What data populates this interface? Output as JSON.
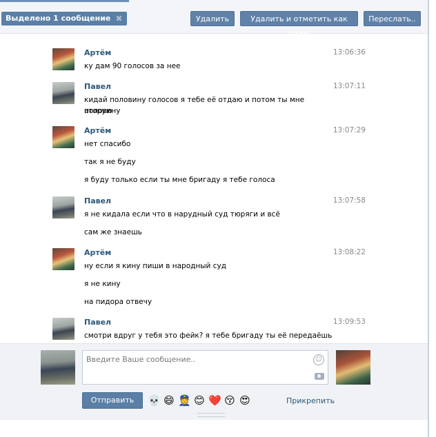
{
  "header": {
    "selected_label": "Выделено 1 сообщение",
    "close_glyph": "✖",
    "buttons": {
      "delete": "Удалить",
      "delete_spam": "Удалить и отметить как спам",
      "forward": "Переслать.."
    }
  },
  "messages": [
    {
      "author": "Артём",
      "time": "13:06:36",
      "lines": [
        "ку дам 90 голосов за нее"
      ]
    },
    {
      "author": "Павел",
      "time": "13:07:11",
      "lines": [
        "кидай половину голосов я тебе её отдаю и потом ты мне вторую",
        "половину"
      ]
    },
    {
      "author": "Артём",
      "time": "13:07:29",
      "lines": [
        "нет спасибо",
        "так я не буду",
        "я буду только если ты мне бригаду я тебе голоса"
      ]
    },
    {
      "author": "Павел",
      "time": "13:07:58",
      "lines": [
        "я не кидала если что в нарудный суд тюряги и всё",
        "сам же знаешь"
      ]
    },
    {
      "author": "Артём",
      "time": "13:08:22",
      "lines": [
        "ну если я кину пиши в народный суд",
        "я не кину",
        "на пидора отвечу"
      ]
    },
    {
      "author": "Павел",
      "time": "13:09:53",
      "lines": [
        "смотри вдруг у тебя это фейк? я тебе бригаду ты её передаёшь на"
      ]
    }
  ],
  "composer": {
    "placeholder": "Введите Ваше сообщение..",
    "send_label": "Отправить",
    "attach_label": "Прикрепить",
    "emojis": [
      "💀",
      "😄",
      "👮",
      "😊",
      "❤️",
      "😚",
      "😍"
    ],
    "smile_glyph": "☺"
  },
  "colors": {
    "accent": "#5b7fa6",
    "link": "#2b587a",
    "background": "#ffffff",
    "panel": "#f0f2f5"
  }
}
